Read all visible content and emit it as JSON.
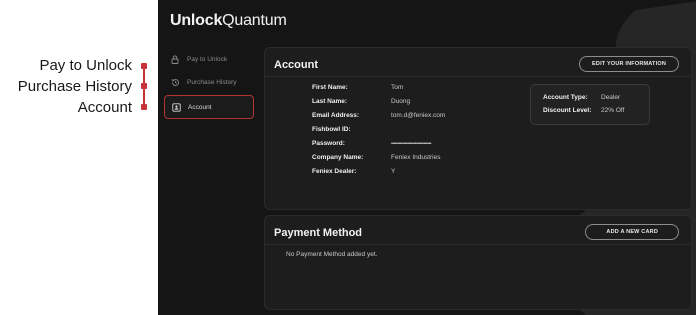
{
  "callouts": [
    "Pay to Unlock",
    "Purchase History",
    "Account"
  ],
  "brand": {
    "bold": "Unlock",
    "light": "Quantum"
  },
  "sidebar": {
    "items": [
      {
        "label": "Pay to Unlock",
        "icon": "lock-icon"
      },
      {
        "label": "Purchase History",
        "icon": "history-icon"
      },
      {
        "label": "Account",
        "icon": "account-card-icon",
        "active": true
      }
    ]
  },
  "account": {
    "title": "Account",
    "edit_button": "EDIT YOUR INFORMATION",
    "fields": [
      {
        "label": "First Name:",
        "value": "Tom"
      },
      {
        "label": "Last Name:",
        "value": "Duong"
      },
      {
        "label": "Email Address:",
        "value": "tom.d@feniex.com"
      },
      {
        "label": "Fishbowl ID:",
        "value": ""
      },
      {
        "label": "Password:",
        "value": "••••••••••••••••••••••••••••••••"
      },
      {
        "label": "Company Name:",
        "value": "Feniex Industries"
      },
      {
        "label": "Feniex Dealer:",
        "value": "Y"
      }
    ],
    "type_box": {
      "type_label": "Account Type:",
      "type_value": "Dealer",
      "discount_label": "Discount Level:",
      "discount_value": "22% Off"
    }
  },
  "payment": {
    "title": "Payment Method",
    "add_button": "ADD A NEW CARD",
    "empty_message": "No Payment Method added yet."
  },
  "colors": {
    "accent": "#c8323a",
    "background": "#151515",
    "panel": "#1d1d1d"
  }
}
